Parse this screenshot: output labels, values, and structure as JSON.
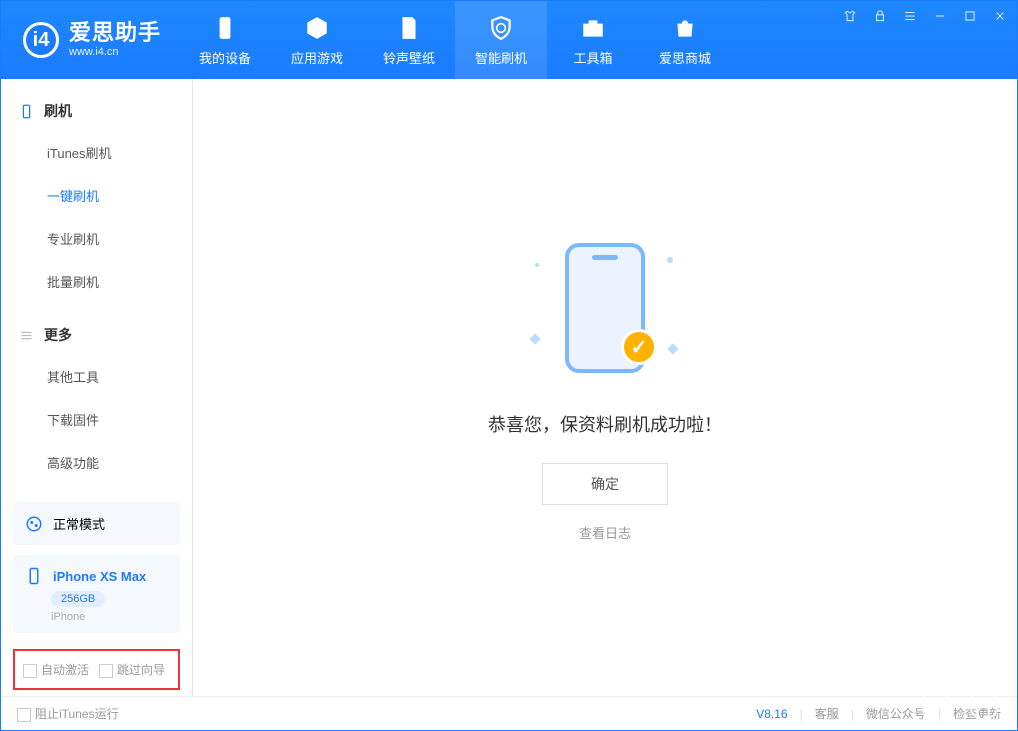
{
  "logo": {
    "name": "爱思助手",
    "url": "www.i4.cn",
    "mark": "i4"
  },
  "nav": {
    "items": [
      {
        "label": "我的设备"
      },
      {
        "label": "应用游戏"
      },
      {
        "label": "铃声壁纸"
      },
      {
        "label": "智能刷机"
      },
      {
        "label": "工具箱"
      },
      {
        "label": "爱思商城"
      }
    ]
  },
  "sidebar": {
    "group1": {
      "title": "刷机",
      "items": [
        "iTunes刷机",
        "一键刷机",
        "专业刷机",
        "批量刷机"
      ]
    },
    "group2": {
      "title": "更多",
      "items": [
        "其他工具",
        "下载固件",
        "高级功能"
      ]
    },
    "mode": "正常模式",
    "device": {
      "name": "iPhone XS Max",
      "storage": "256GB",
      "type": "iPhone"
    },
    "opts": {
      "auto_activate": "自动激活",
      "skip_guide": "跳过向导"
    }
  },
  "main": {
    "success_text": "恭喜您，保资料刷机成功啦！",
    "ok": "确定",
    "view_log": "查看日志"
  },
  "footer": {
    "block_itunes": "阻止iTunes运行",
    "version": "V8.16",
    "links": [
      "客服",
      "微信公众号",
      "检查更新"
    ]
  }
}
